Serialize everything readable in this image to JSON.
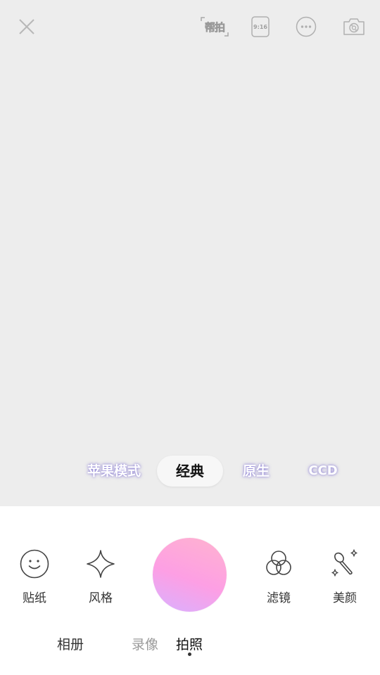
{
  "top_bar": {
    "close_icon": "close-icon",
    "help_label": "帮拍",
    "ratio_label": "9:16",
    "more_icon": "more-icon",
    "switch_camera_icon": "switch-camera-icon"
  },
  "modes": {
    "items": [
      "苹果模式",
      "经典",
      "原生",
      "CCD"
    ],
    "selected": "经典"
  },
  "tools": {
    "sticker": {
      "label": "贴纸",
      "icon": "smile-icon"
    },
    "style": {
      "label": "风格",
      "icon": "sparkle-icon"
    },
    "filter": {
      "label": "滤镜",
      "icon": "filter-circles-icon"
    },
    "beauty": {
      "label": "美颜",
      "icon": "magic-wand-icon"
    }
  },
  "bottom_nav": {
    "album": "相册",
    "video": "录像",
    "photo": "拍照",
    "selected": "拍照"
  },
  "colors": {
    "shutter_gradient": [
      "#ffb3cf",
      "#fd9fe4",
      "#d9b0ff"
    ],
    "viewfinder_bg": "#ededed"
  }
}
